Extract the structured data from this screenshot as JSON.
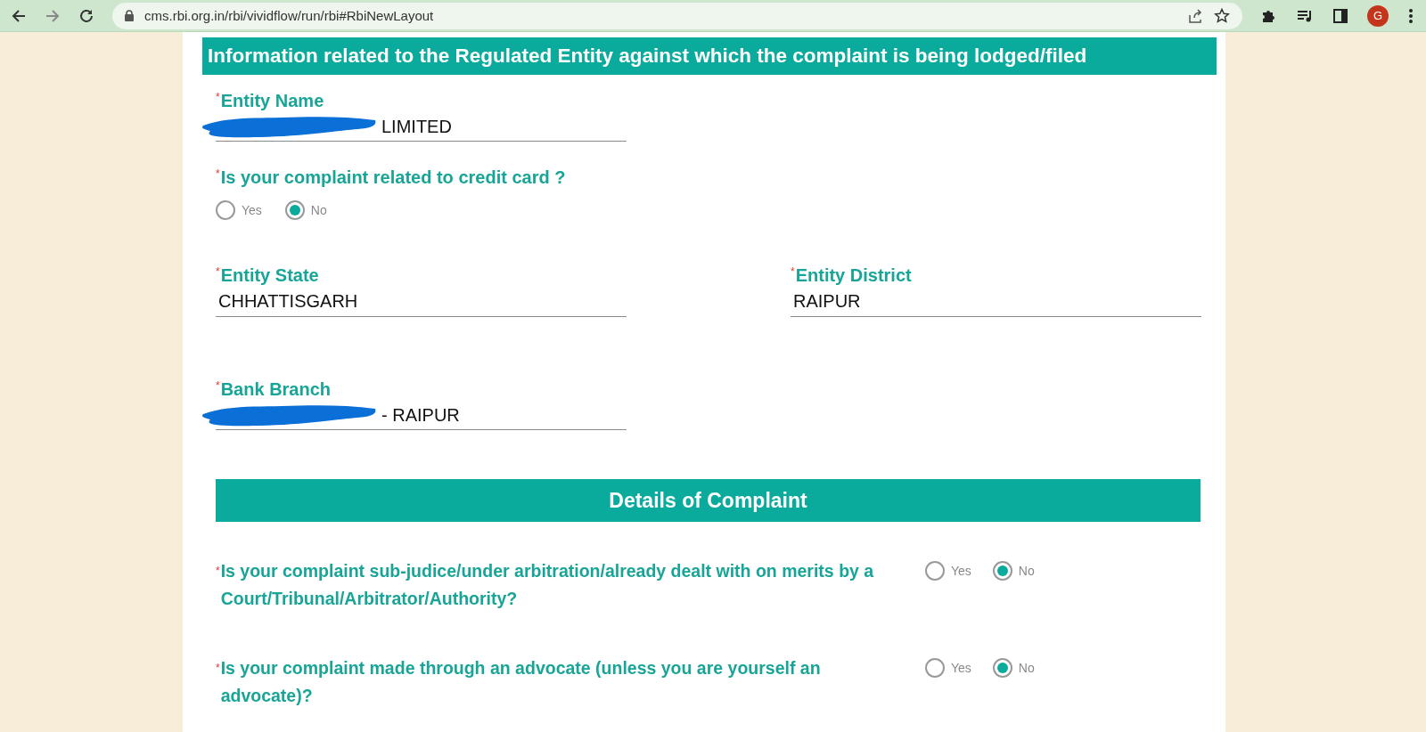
{
  "browser": {
    "url": "cms.rbi.org.in/rbi/vividflow/run/rbi#RbiNewLayout",
    "profile_initial": "G"
  },
  "form": {
    "title": "Information related to the Regulated Entity against which the complaint is being lodged/filed",
    "rows": [
      {
        "fields": [
          {
            "kind": "text",
            "required_mark": "*",
            "label": "Entity Name",
            "value": "LIMITED",
            "redacted": true
          }
        ]
      },
      {
        "fields": [
          {
            "kind": "radio",
            "required_mark": "*",
            "label": "Is your complaint related to credit card ?",
            "options": [
              {
                "label": "Yes",
                "selected": false
              },
              {
                "label": "No",
                "selected": true
              }
            ]
          }
        ]
      },
      {
        "fields": [
          {
            "kind": "text",
            "required_mark": "*",
            "label": "Entity State",
            "value": "CHHATTISGARH",
            "redacted": false
          },
          {
            "kind": "text",
            "required_mark": "*",
            "label": "Entity District",
            "value": "RAIPUR",
            "redacted": false
          }
        ]
      },
      {
        "fields": [
          {
            "kind": "text",
            "required_mark": "*",
            "label": "Bank Branch",
            "value": "- RAIPUR",
            "redacted": true
          }
        ]
      }
    ],
    "section": {
      "title": "Details of Complaint",
      "questions": [
        {
          "required_mark": "*",
          "label": "Is your complaint sub-judice/under arbitration/already dealt with on merits by a Court/Tribunal/Arbitrator/Authority?",
          "options": [
            {
              "label": "Yes",
              "selected": false
            },
            {
              "label": "No",
              "selected": true
            }
          ]
        },
        {
          "required_mark": "*",
          "label": "Is your complaint made through an advocate (unless you are yourself an advocate)?",
          "options": [
            {
              "label": "Yes",
              "selected": false
            },
            {
              "label": "No",
              "selected": true
            }
          ]
        }
      ]
    }
  }
}
